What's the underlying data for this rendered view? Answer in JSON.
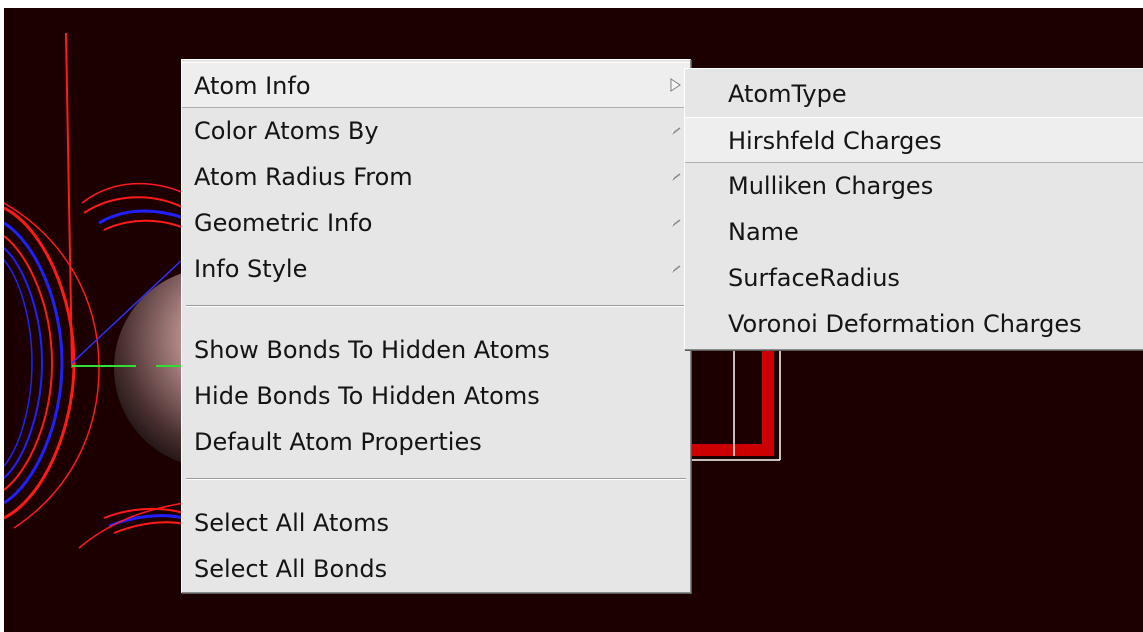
{
  "main_menu": {
    "items_group1": [
      {
        "label": "Atom Info",
        "has_submenu": true,
        "active": true
      },
      {
        "label": "Color Atoms By",
        "has_submenu": true
      },
      {
        "label": "Atom Radius From",
        "has_submenu": true
      },
      {
        "label": "Geometric Info",
        "has_submenu": true
      },
      {
        "label": "Info Style",
        "has_submenu": true
      }
    ],
    "items_group2": [
      {
        "label": "Show Bonds To Hidden Atoms"
      },
      {
        "label": "Hide Bonds To Hidden Atoms"
      },
      {
        "label": "Default Atom Properties"
      }
    ],
    "items_group3": [
      {
        "label": "Select All Atoms"
      },
      {
        "label": "Select All Bonds"
      }
    ]
  },
  "submenu_atom_info": {
    "items": [
      {
        "label": "AtomType"
      },
      {
        "label": "Hirshfeld Charges",
        "highlighted": true
      },
      {
        "label": "Mulliken Charges"
      },
      {
        "label": "Name"
      },
      {
        "label": "SurfaceRadius"
      },
      {
        "label": "Voronoi Deformation Charges"
      }
    ]
  },
  "colors": {
    "viewport_bg": "#1c0000",
    "menu_bg": "#e6e6e6",
    "contour_red": "#ff1a1a",
    "contour_blue": "#2020ff",
    "axis_green": "#33dd33",
    "bond_red": "#cc0000"
  }
}
